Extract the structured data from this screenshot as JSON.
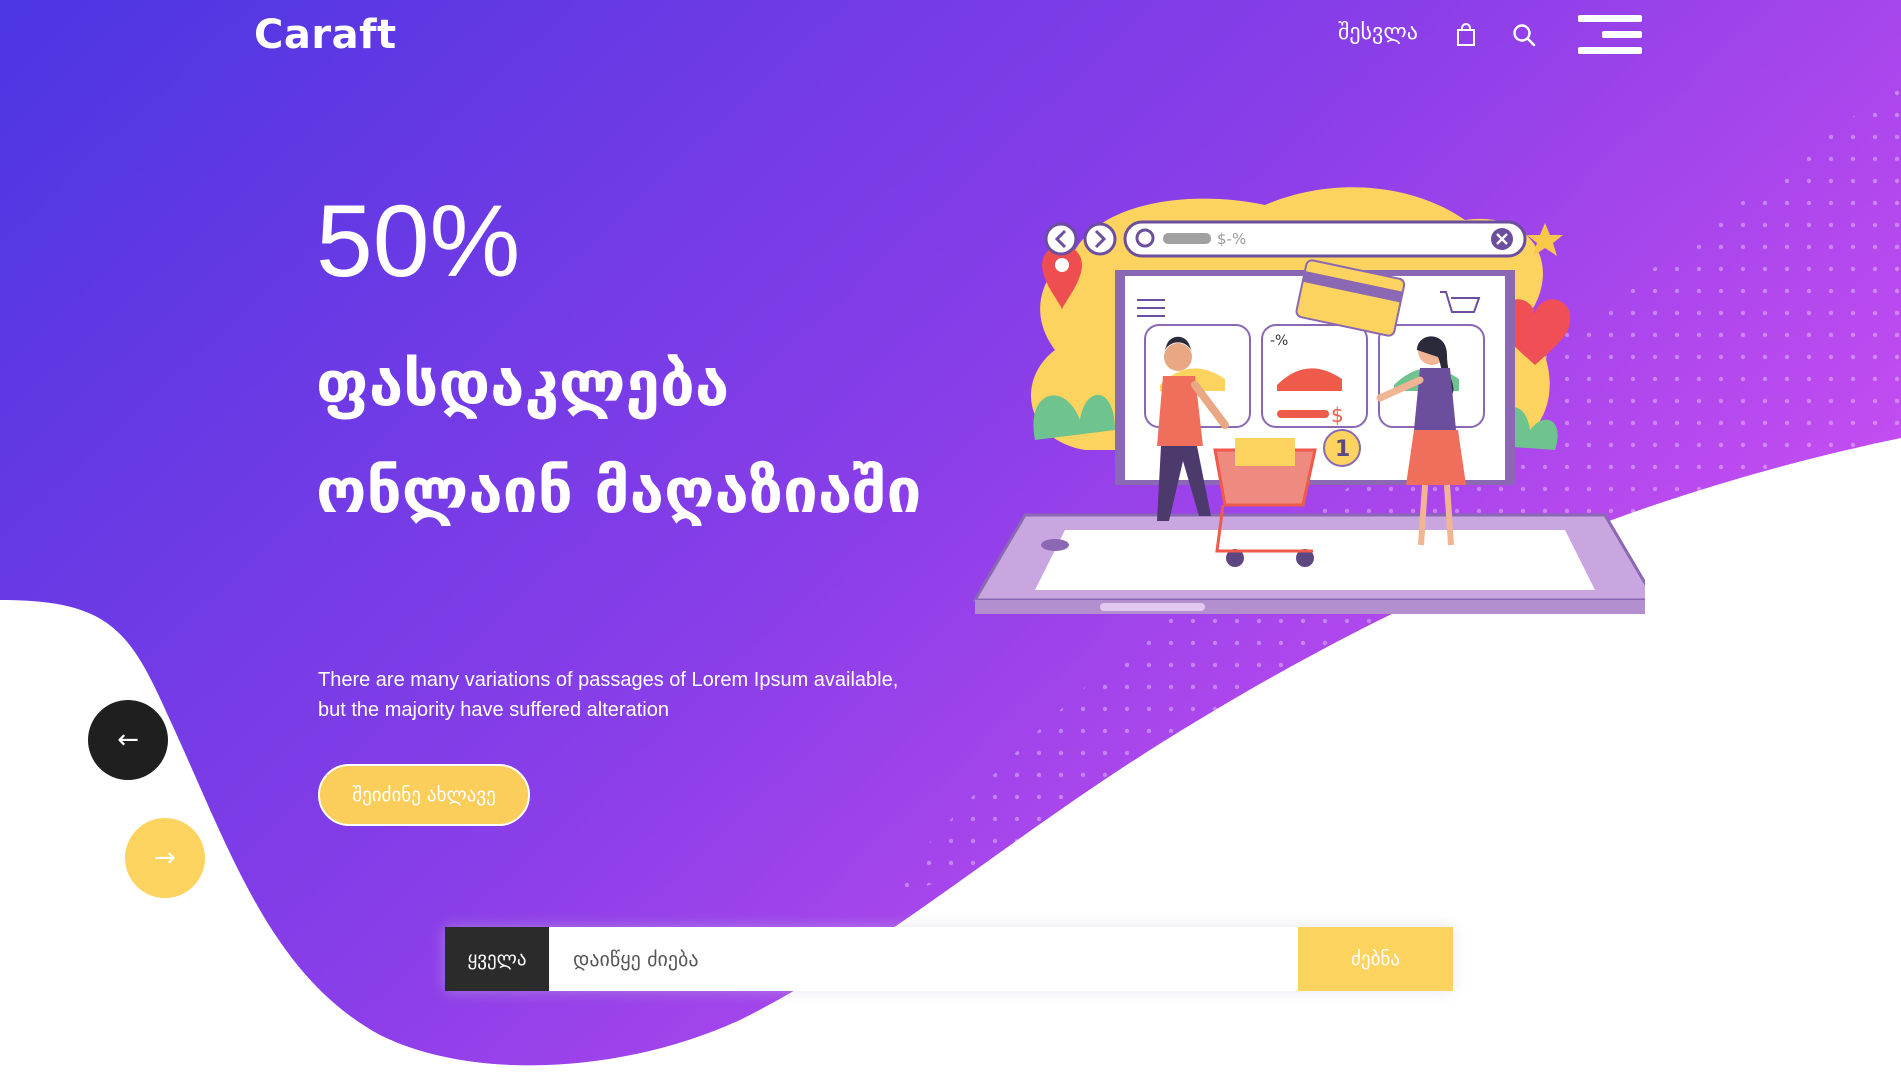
{
  "header": {
    "logo": "Caraft",
    "login_label": "შესვლა",
    "bag_icon": "shopping-bag-icon",
    "search_icon": "search-icon",
    "menu_icon": "hamburger-menu-icon"
  },
  "hero": {
    "discount": "50%",
    "title": "ფასდაკლება ონლაინ მაღაზიაში",
    "subtitle_line1": "There are many variations of passages of Lorem Ipsum available,",
    "subtitle_line2": "but the majority have suffered alteration",
    "cta_label": "შეიძინე ახლავე"
  },
  "carousel": {
    "prev_label": "←",
    "next_label": "→"
  },
  "illustration": {
    "url_text": "$-%",
    "price_tag": "-%",
    "dollar": "$",
    "cart_count": "1"
  },
  "search": {
    "category_label": "ყველა",
    "placeholder": "დაიწყე ძიება",
    "value": "",
    "submit_label": "ძებნა"
  },
  "colors": {
    "gradient_start": "#4f35e4",
    "gradient_end": "#c44cf0",
    "accent_yellow": "#fbd35e",
    "dark": "#2b2b2b"
  }
}
